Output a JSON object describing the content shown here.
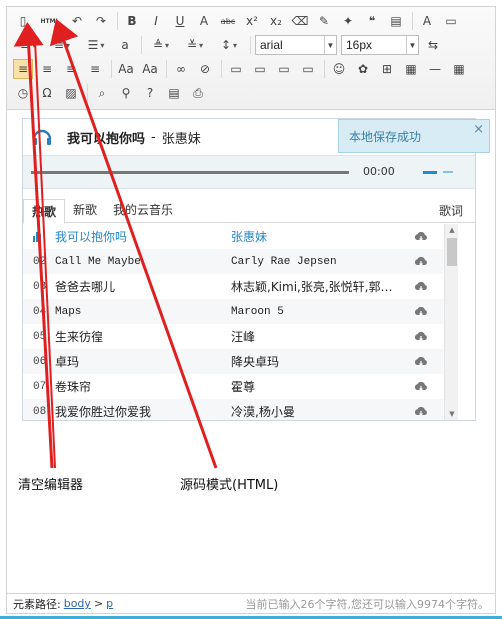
{
  "toolbar": {
    "row1": [
      {
        "name": "new-document-icon",
        "glyph": "▯"
      },
      {
        "name": "source-html-button",
        "glyph": "HTML"
      },
      {
        "name": "undo-icon",
        "glyph": "↶"
      },
      {
        "name": "redo-icon",
        "glyph": "↷"
      },
      {
        "name": "bold-button",
        "glyph": "B"
      },
      {
        "name": "italic-button",
        "glyph": "I"
      },
      {
        "name": "underline-button",
        "glyph": "U"
      },
      {
        "name": "font-border-button",
        "glyph": "A"
      },
      {
        "name": "strikethrough-button",
        "glyph": "abc"
      },
      {
        "name": "superscript-button",
        "glyph": "x²"
      },
      {
        "name": "subscript-button",
        "glyph": "x₂"
      },
      {
        "name": "eraser-icon",
        "glyph": "⌫"
      },
      {
        "name": "format-brush-icon",
        "glyph": "✎"
      },
      {
        "name": "auto-format-icon",
        "glyph": "✦"
      },
      {
        "name": "blockquote-icon",
        "glyph": "❝"
      },
      {
        "name": "paste-plain-icon",
        "glyph": "▤"
      },
      {
        "name": "font-color-icon",
        "glyph": "A"
      },
      {
        "name": "fullscreen-icon",
        "glyph": "▭"
      }
    ],
    "row2": [
      {
        "name": "ordered-list-icon",
        "glyph": "≡"
      },
      {
        "name": "line-height-icon",
        "glyph": "≡"
      },
      {
        "name": "unordered-list-icon",
        "glyph": "☰"
      },
      {
        "name": "select-all-icon",
        "glyph": "a"
      },
      {
        "name": "paragraph-spacing-top-icon",
        "glyph": "≜"
      },
      {
        "name": "paragraph-spacing-bottom-icon",
        "glyph": "≚"
      },
      {
        "name": "row-spacing-icon",
        "glyph": "↕"
      }
    ],
    "font_family": "arial",
    "font_size": "16px",
    "row3": [
      {
        "name": "align-left-icon",
        "glyph": "≡",
        "active": true
      },
      {
        "name": "align-center-icon",
        "glyph": "≡"
      },
      {
        "name": "align-right-icon",
        "glyph": "≡"
      },
      {
        "name": "align-justify-icon",
        "glyph": "≡"
      },
      {
        "name": "to-uppercase-icon",
        "glyph": "Aa"
      },
      {
        "name": "to-lowercase-icon",
        "glyph": "Aa"
      },
      {
        "name": "link-icon",
        "glyph": "∞"
      },
      {
        "name": "unlink-icon",
        "glyph": "⊘"
      },
      {
        "name": "image-left-icon",
        "glyph": "▭"
      },
      {
        "name": "image-none-icon",
        "glyph": "▭"
      },
      {
        "name": "image-right-icon",
        "glyph": "▭"
      },
      {
        "name": "image-center-icon",
        "glyph": "▭"
      },
      {
        "name": "emotion-icon",
        "glyph": "☺"
      },
      {
        "name": "scrawl-icon",
        "glyph": "✿"
      },
      {
        "name": "insert-frame-icon",
        "glyph": "⊞"
      },
      {
        "name": "insert-table-icon",
        "glyph": "▦"
      },
      {
        "name": "horizontal-rule-icon",
        "glyph": "—"
      },
      {
        "name": "date-icon",
        "glyph": "▦"
      }
    ],
    "row4": [
      {
        "name": "time-icon",
        "glyph": "◷"
      },
      {
        "name": "special-chars-icon",
        "glyph": "Ω"
      },
      {
        "name": "background-icon",
        "glyph": "▨"
      },
      {
        "name": "preview-icon",
        "glyph": "⌕"
      },
      {
        "name": "search-replace-icon",
        "glyph": "⚲"
      },
      {
        "name": "help-icon",
        "glyph": "?"
      },
      {
        "name": "template-icon",
        "glyph": "▤"
      },
      {
        "name": "print-icon",
        "glyph": "⎙"
      }
    ]
  },
  "music": {
    "title": "我可以抱你吗",
    "dash": "-",
    "artist": "张惠妹",
    "time": "00:00",
    "tabs": [
      {
        "label": "热歌",
        "active": true
      },
      {
        "label": "新歌",
        "active": false
      },
      {
        "label": "我的云音乐",
        "active": false
      }
    ],
    "lyrics_tab": "歌词",
    "songs": [
      {
        "idx": "",
        "name": "我可以抱你吗",
        "artist": "张惠妹",
        "playing": true,
        "mono": false
      },
      {
        "idx": "02",
        "name": "Call Me Maybe",
        "artist": "Carly Rae Jepsen",
        "playing": false,
        "mono": true
      },
      {
        "idx": "03",
        "name": "爸爸去哪儿",
        "artist": "林志颖,Kimi,张亮,张悦轩,郭…",
        "playing": false,
        "mono": false
      },
      {
        "idx": "04",
        "name": "Maps",
        "artist": "Maroon 5",
        "playing": false,
        "mono": true
      },
      {
        "idx": "05",
        "name": "生来彷徨",
        "artist": "汪峰",
        "playing": false,
        "mono": false
      },
      {
        "idx": "06",
        "name": "卓玛",
        "artist": "降央卓玛",
        "playing": false,
        "mono": false
      },
      {
        "idx": "07",
        "name": "卷珠帘",
        "artist": "霍尊",
        "playing": false,
        "mono": false
      },
      {
        "idx": "08",
        "name": "我爱你胜过你爱我",
        "artist": "冷漠,杨小曼",
        "playing": false,
        "mono": false
      }
    ]
  },
  "toast": {
    "text": "本地保存成功",
    "close": "×"
  },
  "annotations": {
    "clear_editor": "清空编辑器",
    "source_mode": "源码模式(HTML)"
  },
  "status": {
    "path_label": "元素路径:",
    "path_body": "body",
    "path_sep": ">",
    "path_p": "p",
    "char_count": "当前已输入26个字符,您还可以输入9974个字符。"
  },
  "colors": {
    "arrow": "#e02020",
    "accent_blue": "#2489c5",
    "toast_bg": "#d7ecf5"
  }
}
